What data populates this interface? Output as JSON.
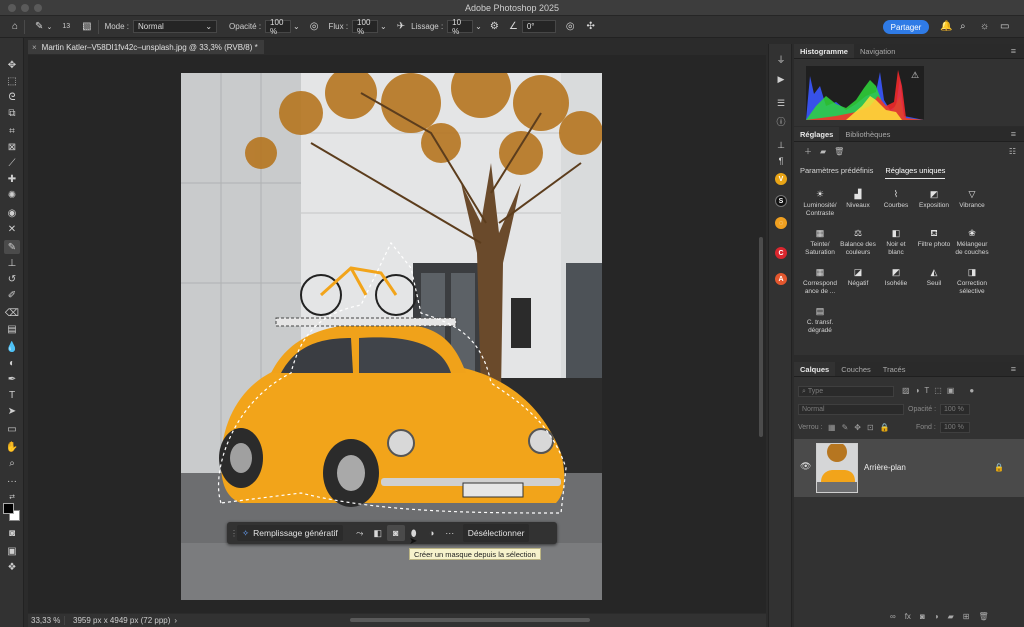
{
  "window": {
    "title": "Adobe Photoshop 2025"
  },
  "options_bar": {
    "brush_size": "13",
    "mode_label": "Mode :",
    "mode_value": "Normal",
    "opacity_label": "Opacité :",
    "opacity_value": "100 %",
    "flow_label": "Flux :",
    "flow_value": "100 %",
    "smoothing_label": "Lissage :",
    "smoothing_value": "10 %",
    "angle_value": "0°",
    "share_label": "Partager"
  },
  "document": {
    "tab_title": "Martin Katler–V58DI1fv42c–unsplash.jpg @ 33,3% (RVB/8) *",
    "zoom": "33,33 %",
    "dimensions": "3959 px x 4949 px (72 ppp)"
  },
  "task_bar": {
    "generative_fill": "Remplissage génératif",
    "deselect": "Désélectionner",
    "tooltip": "Créer un masque depuis la sélection"
  },
  "histogram_panel": {
    "tabs": [
      "Histogramme",
      "Navigation"
    ]
  },
  "adjustments_panel": {
    "tabs": [
      "Réglages",
      "Bibliothèques"
    ],
    "subtabs": [
      "Paramètres prédéfinis",
      "Réglages uniques"
    ],
    "items": [
      {
        "label": "Luminosité/\nContraste",
        "icon": "brightness-icon"
      },
      {
        "label": "Niveaux",
        "icon": "levels-icon"
      },
      {
        "label": "Courbes",
        "icon": "curves-icon"
      },
      {
        "label": "Exposition",
        "icon": "exposure-icon"
      },
      {
        "label": "Vibrance",
        "icon": "vibrance-icon"
      },
      {
        "label": "Teinte/\nSaturation",
        "icon": "hue-icon"
      },
      {
        "label": "Balance des\ncouleurs",
        "icon": "balance-icon"
      },
      {
        "label": "Noir et\nblanc",
        "icon": "bw-icon"
      },
      {
        "label": "Filtre photo",
        "icon": "photo-filter-icon"
      },
      {
        "label": "Mélangeur\nde couches",
        "icon": "mixer-icon"
      },
      {
        "label": "Correspond\nance de ...",
        "icon": "lookup-icon"
      },
      {
        "label": "Négatif",
        "icon": "invert-icon"
      },
      {
        "label": "Isohélie",
        "icon": "posterize-icon"
      },
      {
        "label": "Seuil",
        "icon": "threshold-icon"
      },
      {
        "label": "Correction\nsélective",
        "icon": "selective-icon"
      },
      {
        "label": "C. transf.\ndégradé",
        "icon": "gradient-map-icon"
      }
    ]
  },
  "layers_panel": {
    "tabs": [
      "Calques",
      "Couches",
      "Tracés"
    ],
    "filter_placeholder": "Type",
    "blend_mode": "Normal",
    "opacity_label": "Opacité :",
    "opacity_value": "100 %",
    "lock_label": "Verrou :",
    "fill_label": "Fond :",
    "fill_value": "100 %",
    "layers": [
      {
        "name": "Arrière-plan"
      }
    ]
  },
  "colors": {
    "accent": "#2f7be6",
    "selection_tooltip_bg": "#f6f2cc",
    "car": "#f2a41a"
  }
}
